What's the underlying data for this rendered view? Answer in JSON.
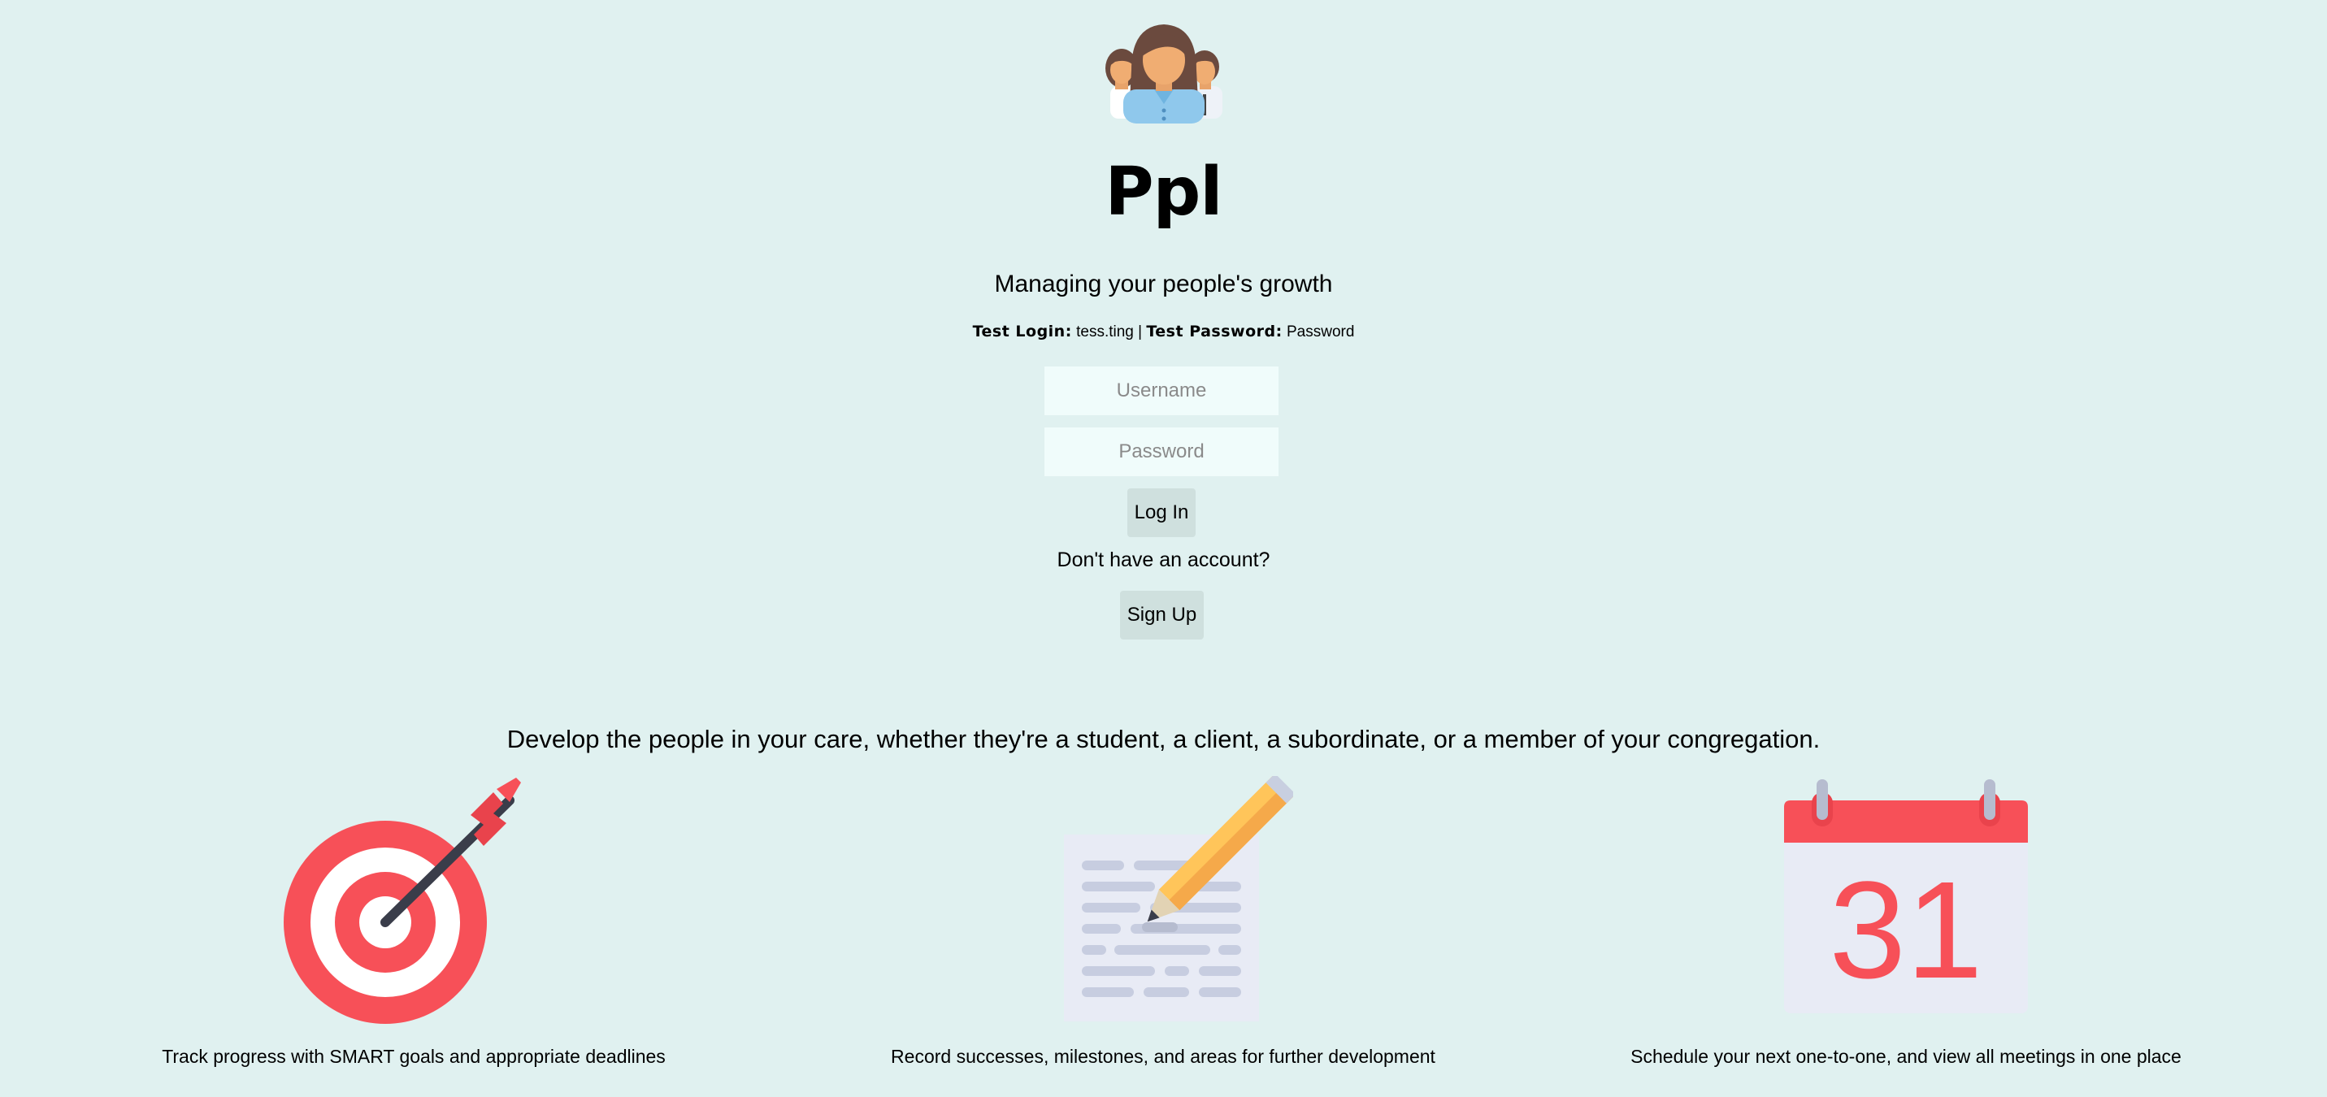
{
  "app": {
    "title": "Ppl",
    "logo_icon": "people-group-icon",
    "tagline": "Managing your people's growth"
  },
  "test_credentials": {
    "login_label": "Test Login:",
    "login_value": "tess.ting",
    "separator": "|",
    "password_label": "Test Password:",
    "password_value": "Password"
  },
  "form": {
    "username_placeholder": "Username",
    "password_placeholder": "Password",
    "login_button": "Log In",
    "no_account_text": "Don't have an account?",
    "signup_button": "Sign Up"
  },
  "intro": "Develop the people in your care, whether they're a student, a client, a subordinate, or a member of your congregation.",
  "features": [
    {
      "icon": "target-arrow-icon",
      "caption": "Track progress with SMART goals and appropriate deadlines"
    },
    {
      "icon": "document-pencil-icon",
      "caption": "Record successes, milestones, and areas for further development"
    },
    {
      "icon": "calendar-icon",
      "caption": "Schedule your next one-to-one, and view all meetings in one place",
      "calendar_day": "31"
    }
  ],
  "colors": {
    "background": "#e0f1f0",
    "input_bg": "#f0fcfb",
    "button_bg": "#cfe0de",
    "accent_red": "#f75058"
  }
}
